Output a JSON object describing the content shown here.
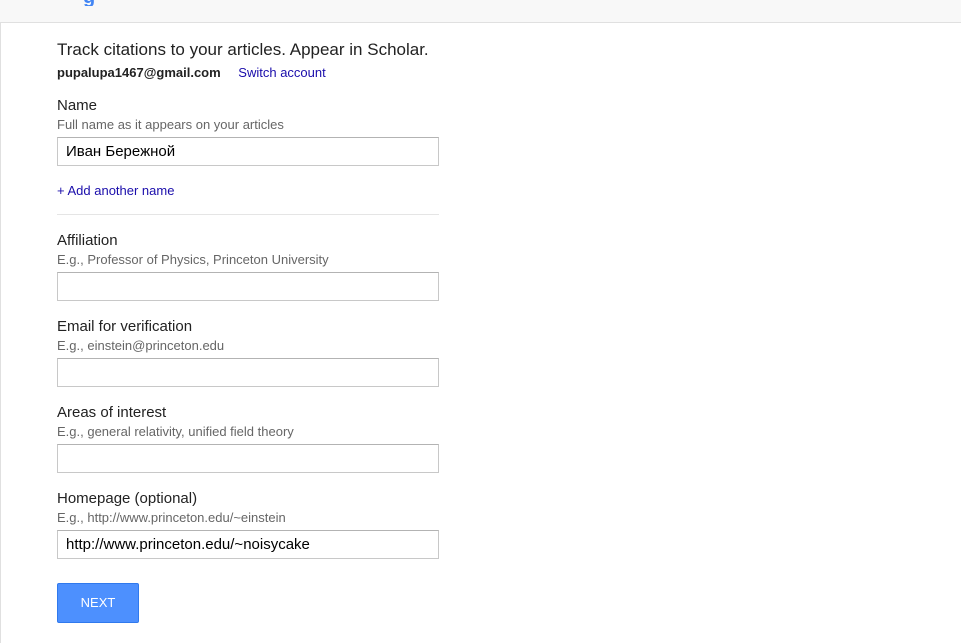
{
  "form": {
    "headline": "Track citations to your articles. Appear in Scholar.",
    "account_email": "pupalupa1467@gmail.com",
    "switch_account": "Switch account",
    "name": {
      "label": "Name",
      "hint": "Full name as it appears on your articles",
      "value": "Иван Бережной"
    },
    "add_another_name": "+ Add another name",
    "affiliation": {
      "label": "Affiliation",
      "hint": "E.g., Professor of Physics, Princeton University",
      "value": ""
    },
    "email_verification": {
      "label": "Email for verification",
      "hint": "E.g., einstein@princeton.edu",
      "value": ""
    },
    "areas_of_interest": {
      "label": "Areas of interest",
      "hint": "E.g., general relativity, unified field theory",
      "value": ""
    },
    "homepage": {
      "label": "Homepage (optional)",
      "hint": "E.g., http://www.princeton.edu/~einstein",
      "value": "http://www.princeton.edu/~noisycake"
    },
    "next_label": "NEXT"
  },
  "colors": {
    "accent": "#4d90fe",
    "link": "#1a0dab"
  }
}
